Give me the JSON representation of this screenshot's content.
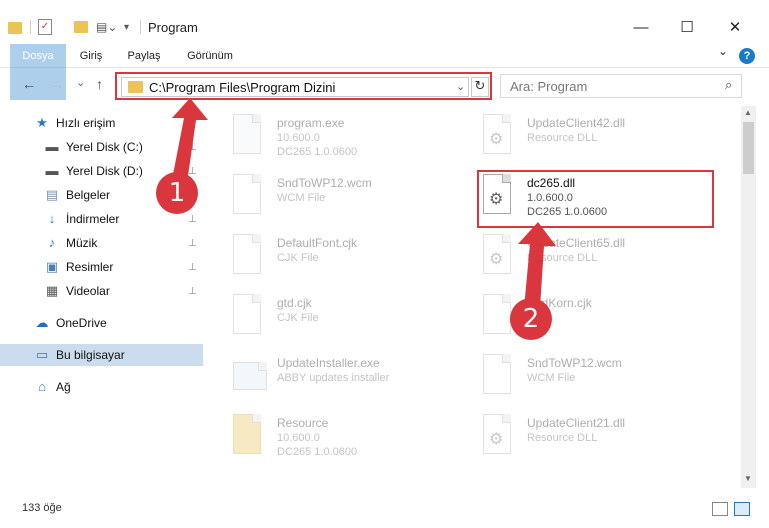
{
  "window": {
    "title": "Program",
    "controls": {
      "minimize": "—",
      "maximize": "☐",
      "close": "✕"
    }
  },
  "ribbon": {
    "tabs": [
      "Dosya",
      "Giriş",
      "Paylaş",
      "Görünüm"
    ],
    "expand": "⌄",
    "help": "?"
  },
  "nav": {
    "back": "←",
    "forward": "→",
    "recent": "⌄",
    "up": "↑",
    "address": "C:\\Program Files\\Program Dizini",
    "address_chevron": "⌄",
    "refresh": "↻",
    "search_placeholder": "Ara: Program",
    "search_icon": "⌕"
  },
  "sidebar": {
    "items": [
      {
        "label": "Hızlı erişim",
        "icon": "star-icon",
        "glyph": "★",
        "color": "#2b79d1"
      },
      {
        "label": "Yerel Disk (C:)",
        "icon": "drive-icon",
        "glyph": "▬",
        "color": "#555555",
        "pinned": true
      },
      {
        "label": "Yerel Disk (D:)",
        "icon": "drive-icon",
        "glyph": "▬",
        "color": "#555555",
        "pinned": true
      },
      {
        "label": "Belgeler",
        "icon": "documents-icon",
        "glyph": "▤",
        "color": "#7a8fa8",
        "pinned": true
      },
      {
        "label": "İndirmeler",
        "icon": "download-icon",
        "glyph": "↓",
        "color": "#2b79d1",
        "pinned": true
      },
      {
        "label": "Müzik",
        "icon": "music-icon",
        "glyph": "♪",
        "color": "#2b79d1",
        "pinned": true
      },
      {
        "label": "Resimler",
        "icon": "pictures-icon",
        "glyph": "▣",
        "color": "#4a7fb5",
        "pinned": true
      },
      {
        "label": "Videolar",
        "icon": "videos-icon",
        "glyph": "▦",
        "color": "#555555",
        "pinned": true
      },
      {
        "label": "OneDrive",
        "icon": "cloud-icon",
        "glyph": "☁",
        "color": "#1e6fc9"
      },
      {
        "label": "Bu bilgisayar",
        "icon": "computer-icon",
        "glyph": "▭",
        "color": "#2b79d1",
        "selected": true
      },
      {
        "label": "Ağ",
        "icon": "network-icon",
        "glyph": "⌂",
        "color": "#2b79d1"
      }
    ],
    "pin_glyph": "📌"
  },
  "files": [
    {
      "name": "program.exe",
      "line2": "10.600.0",
      "line3": "DC265 1.0.0600",
      "icon": "exe-icon"
    },
    {
      "name": "UpdateClient42.dll",
      "line2": "Resource DLL",
      "line3": "",
      "icon": "dll-icon"
    },
    {
      "name": "SndToWP12.wcm",
      "line2": "WCM File",
      "line3": "",
      "icon": "file-icon"
    },
    {
      "name": "dc265.dll",
      "line2": "1.0.600.0",
      "line3": "DC265 1.0.0600",
      "icon": "dll-icon",
      "highlight": true
    },
    {
      "name": "DefaultFont.cjk",
      "line2": "CJK File",
      "line3": "",
      "icon": "file-icon"
    },
    {
      "name": "UpdateClient65.dll",
      "line2": "Resource DLL",
      "line3": "",
      "icon": "dll-icon"
    },
    {
      "name": "gtd.cjk",
      "line2": "CJK File",
      "line3": "",
      "icon": "file-icon"
    },
    {
      "name": "SndKorn.cjk",
      "line2": "File",
      "line3": "",
      "icon": "file-icon"
    },
    {
      "name": "UpdateInstaller.exe",
      "line2": "ABBY updates installer",
      "line3": "",
      "icon": "installer-icon"
    },
    {
      "name": "SndToWP12.wcm",
      "line2": "WCM File",
      "line3": "",
      "icon": "file-icon"
    },
    {
      "name": "Resource",
      "line2": "10.600.0",
      "line3": "DC265 1.0.0600",
      "icon": "folder-zip-icon"
    },
    {
      "name": "UpdateClient21.dll",
      "line2": "Resource DLL",
      "line3": "",
      "icon": "dll-icon"
    }
  ],
  "status": {
    "count": "133 öğe"
  },
  "callouts": [
    "1",
    "2"
  ],
  "colors": {
    "accent": "#1979ca",
    "highlight": "#d9363e",
    "selected": "#ccdcef"
  }
}
